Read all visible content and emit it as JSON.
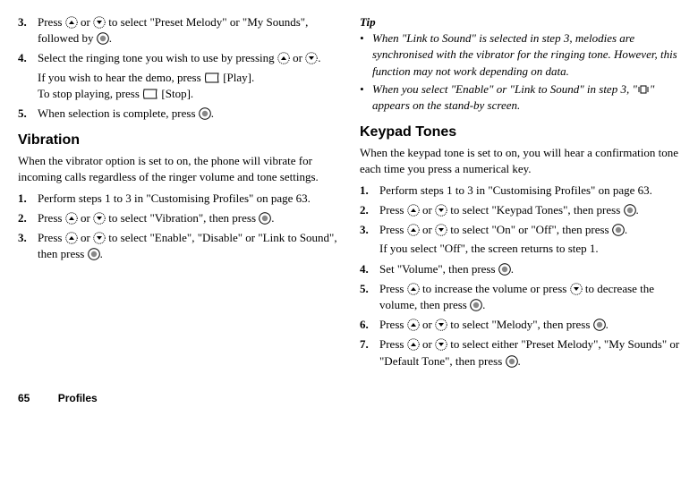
{
  "left": {
    "step3": {
      "num": "3.",
      "text_a": "Press ",
      "text_b": " or ",
      "text_c": " to select \"Preset Melody\" or \"My Sounds\", followed by ",
      "text_d": "."
    },
    "step4": {
      "num": "4.",
      "text_a": "Select the ringing tone you wish to use by pressing ",
      "text_b": " or ",
      "text_c": ".",
      "line2a": "If you wish to hear the demo, press ",
      "line2b": " [Play].",
      "line3a": "To stop playing, press ",
      "line3b": " [Stop]."
    },
    "step5": {
      "num": "5.",
      "text_a": "When selection is complete, press ",
      "text_b": "."
    },
    "vibration": {
      "heading": "Vibration",
      "intro": "When the vibrator option is set to on, the phone will vibrate for incoming calls regardless of the ringer volume and tone settings.",
      "step1": {
        "num": "1.",
        "text": "Perform steps 1 to 3 in \"Customising Profiles\" on page 63."
      },
      "step2": {
        "num": "2.",
        "text_a": "Press ",
        "text_b": " or ",
        "text_c": " to select \"Vibration\", then press ",
        "text_d": "."
      },
      "step3": {
        "num": "3.",
        "text_a": "Press ",
        "text_b": " or ",
        "text_c": " to select \"Enable\", \"Disable\" or \"Link to Sound\", then press ",
        "text_d": "."
      }
    }
  },
  "right": {
    "tip": {
      "head": "Tip",
      "i1": "When \"Link to Sound\" is selected in step 3, melodies are synchronised with the vibrator for the ringing tone. However, this function may not work depending on data.",
      "i2a": "When you select \"Enable\" or \"Link to Sound\" in step 3, \"",
      "i2b": "\" appears on the stand-by screen."
    },
    "keypad": {
      "heading": "Keypad Tones",
      "intro": "When the keypad tone is set to on, you will hear a confirmation tone each time you press a numerical key.",
      "s1": {
        "num": "1.",
        "text": "Perform steps 1 to 3 in \"Customising Profiles\" on page 63."
      },
      "s2": {
        "num": "2.",
        "a": "Press ",
        "b": " or ",
        "c": " to select \"Keypad Tones\", then press ",
        "d": "."
      },
      "s3": {
        "num": "3.",
        "a": "Press ",
        "b": " or ",
        "c": " to select \"On\" or \"Off\", then press ",
        "d": ".",
        "sub": "If you select \"Off\", the screen returns to step 1."
      },
      "s4": {
        "num": "4.",
        "a": "Set \"Volume\", then press ",
        "b": "."
      },
      "s5": {
        "num": "5.",
        "a": "Press ",
        "b": " to increase the volume or press ",
        "c": " to decrease the volume, then press ",
        "d": "."
      },
      "s6": {
        "num": "6.",
        "a": "Press ",
        "b": " or ",
        "c": " to select \"Melody\", then press ",
        "d": "."
      },
      "s7": {
        "num": "7.",
        "a": "Press ",
        "b": " or ",
        "c": " to select either \"Preset Melody\", \"My Sounds\" or \"Default Tone\", then press ",
        "d": "."
      }
    }
  },
  "footer": {
    "page": "65",
    "section": "Profiles"
  }
}
